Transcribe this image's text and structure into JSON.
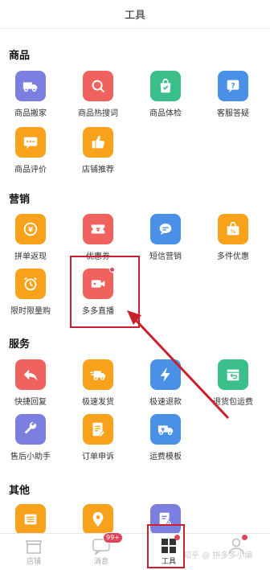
{
  "header": {
    "title": "工具"
  },
  "sections": {
    "goods": {
      "title": "商品"
    },
    "marketing": {
      "title": "营销"
    },
    "service": {
      "title": "服务"
    },
    "other": {
      "title": "其他"
    }
  },
  "tools": {
    "goods_move": "商品搬家",
    "goods_hot_search": "商品热搜词",
    "goods_check": "商品体检",
    "cs_answer": "客服答疑",
    "goods_review": "商品评价",
    "store_recommend": "店铺推荐",
    "cashback": "拼单返现",
    "coupon": "优惠券",
    "sms_marketing": "短信营销",
    "multi_discount": "多件优惠",
    "flash_sale": "限时限量购",
    "live_stream": "多多直播",
    "quick_reply": "快捷回复",
    "fast_ship": "极速发货",
    "fast_refund": "极速退款",
    "return_shipping": "退货包运费",
    "aftersale_helper": "售后小助手",
    "order_appeal": "订单申诉",
    "shipping_template": "运费模板"
  },
  "tabbar": {
    "store": "店铺",
    "messages": "消息",
    "messages_badge": "99+",
    "tools": "工具",
    "me": ""
  },
  "watermark": "知乎 @ 拼多多小编",
  "colors": {
    "purple": "#7b7fe0",
    "red": "#f0625e",
    "green": "#3bbf8a",
    "blue": "#4a90e6",
    "orange": "#f7a21a",
    "annotation": "#c8202c"
  }
}
